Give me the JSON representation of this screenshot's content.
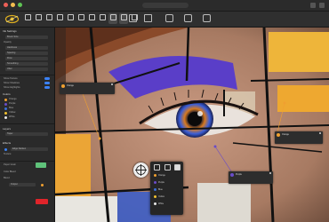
{
  "window": {
    "url_text": ""
  },
  "toolbar": {
    "tools": [
      "",
      "",
      "",
      "",
      "",
      "",
      "",
      "",
      "",
      "",
      "",
      ""
    ]
  },
  "panel": {
    "header": "Ink Settings",
    "rows": [
      "Brush Size",
      "Opacity",
      "Hardness",
      "Spacing",
      "Flow",
      "Smoothing",
      "Jitter",
      "Taper",
      "Texture",
      "Blend"
    ],
    "section_layers": "Layers",
    "layer_toggles": [
      "Show Texture",
      "Show Shadows",
      "Show Highlights"
    ],
    "section_colors": "Colors",
    "colors": [
      {
        "name": "Orange",
        "hex": "#f0a030"
      },
      {
        "name": "Purple",
        "hex": "#6a4cc8"
      },
      {
        "name": "Blue",
        "hex": "#3a6fd8"
      },
      {
        "name": "Yellow",
        "hex": "#f2c230"
      },
      {
        "name": "White",
        "hex": "#e8e8e8"
      }
    ],
    "section_output": "Output",
    "section_effects": "Effects",
    "effects_rows": [
      "Edge Darken",
      "Paper Grain",
      "Color Bleed"
    ],
    "swatch_green": "#5fc27a",
    "swatch_red": "#e0242a"
  },
  "canvas": {
    "annotations": [
      {
        "title": "Orange",
        "body": ""
      },
      {
        "title": "Orange",
        "body": ""
      },
      {
        "title": "Purple",
        "body": ""
      }
    ],
    "popup": {
      "rows": [
        {
          "label": "Orange",
          "color": "#f0a030"
        },
        {
          "label": "Purple",
          "color": "#6a4cc8"
        },
        {
          "label": "Blue",
          "color": "#3a6fd8"
        },
        {
          "label": "Yellow",
          "color": "#f2c230"
        },
        {
          "label": "White",
          "color": "#e8e8e8"
        }
      ]
    }
  }
}
